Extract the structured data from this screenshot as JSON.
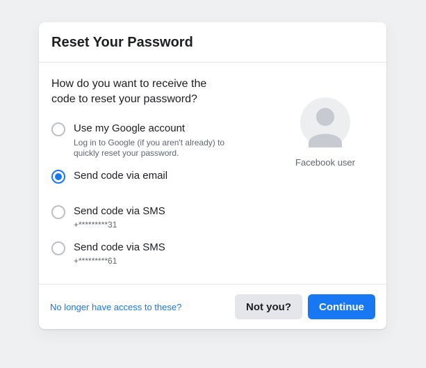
{
  "header": {
    "title": "Reset Your Password"
  },
  "body": {
    "prompt": "How do you want to receive the code to reset your password?",
    "options": [
      {
        "label": "Use my Google account",
        "sub": "Log in to Google (if you aren't already) to quickly reset your password.",
        "selected": false
      },
      {
        "label": "Send code via email",
        "sub": "",
        "selected": true
      },
      {
        "label": "Send code via SMS",
        "sub": "+*********31",
        "selected": false
      },
      {
        "label": "Send code via SMS",
        "sub": "+*********61",
        "selected": false
      }
    ],
    "user_label": "Facebook user"
  },
  "footer": {
    "no_access_link": "No longer have access to these?",
    "not_you": "Not you?",
    "continue": "Continue"
  }
}
